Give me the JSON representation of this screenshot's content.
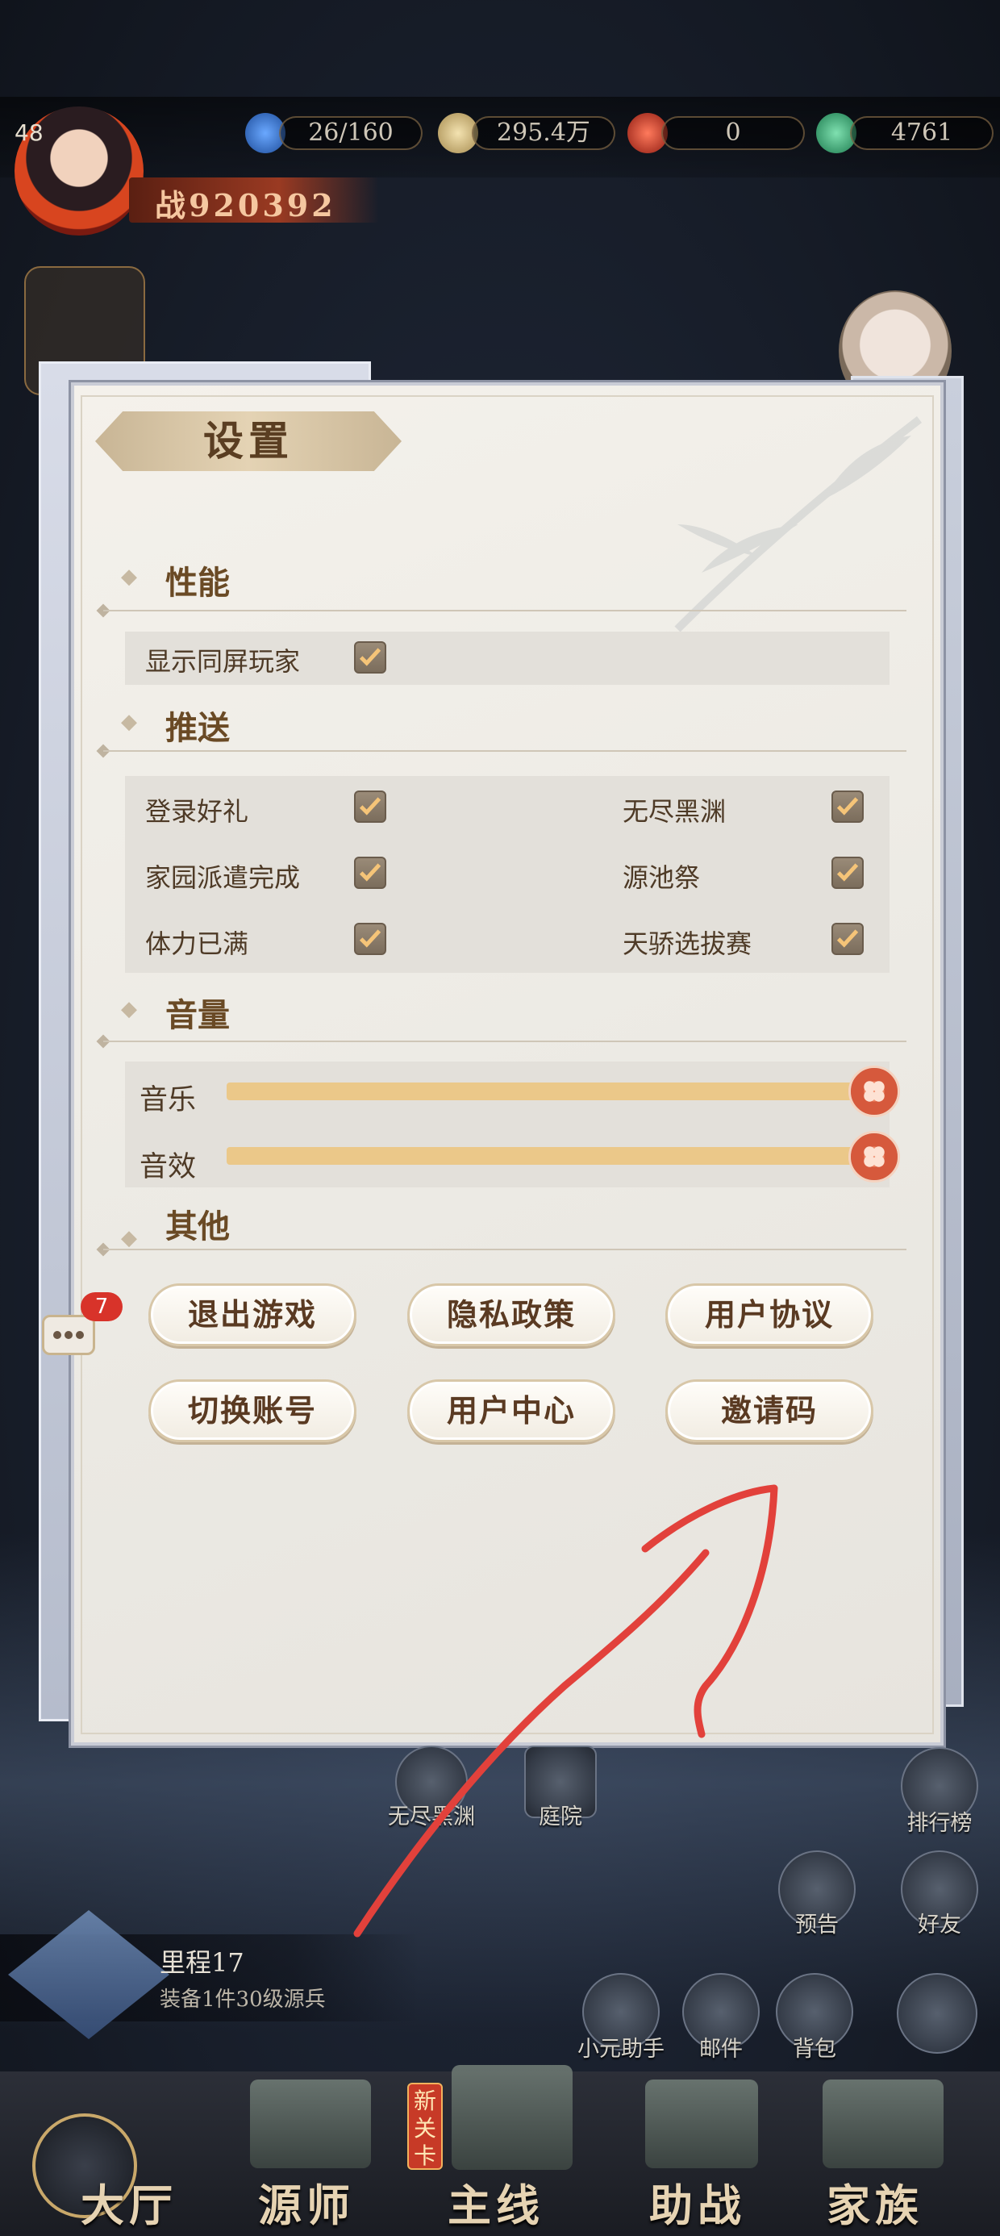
{
  "hud": {
    "level": "48",
    "power": "战920392",
    "resources": [
      "26/160",
      "295.4万",
      "0",
      "4761"
    ]
  },
  "settings": {
    "title": "设置",
    "sections": {
      "performance": "性能",
      "push": "推送",
      "volume": "音量",
      "other": "其他"
    },
    "performance_options": [
      {
        "label": "显示同屏玩家",
        "checked": true
      }
    ],
    "push_options": [
      {
        "label": "登录好礼",
        "checked": true
      },
      {
        "label": "无尽黑渊",
        "checked": true
      },
      {
        "label": "家园派遣完成",
        "checked": true
      },
      {
        "label": "源池祭",
        "checked": true
      },
      {
        "label": "体力已满",
        "checked": true
      },
      {
        "label": "天骄选拔赛",
        "checked": true
      }
    ],
    "volume": [
      {
        "label": "音乐",
        "level": 1.0
      },
      {
        "label": "音效",
        "level": 1.0
      }
    ],
    "buttons": [
      "退出游戏",
      "隐私政策",
      "用户协议",
      "切换账号",
      "用户中心",
      "邀请码"
    ]
  },
  "chat_badge": "7",
  "map_icons": [
    "无尽黑渊",
    "庭院"
  ],
  "right_icons": [
    "排行榜",
    "预告",
    "好友"
  ],
  "bottom_icons": [
    "小元助手",
    "邮件",
    "背包"
  ],
  "mileage": {
    "title": "里程17",
    "task": "装备1件30级源兵"
  },
  "nav": {
    "new_tag": "新关卡",
    "tabs": [
      "大厅",
      "源师",
      "主线",
      "助战",
      "家族"
    ]
  },
  "colors": {
    "accent": "#ebc889",
    "annotation": "#e2413b",
    "panel": "#eceae4"
  }
}
